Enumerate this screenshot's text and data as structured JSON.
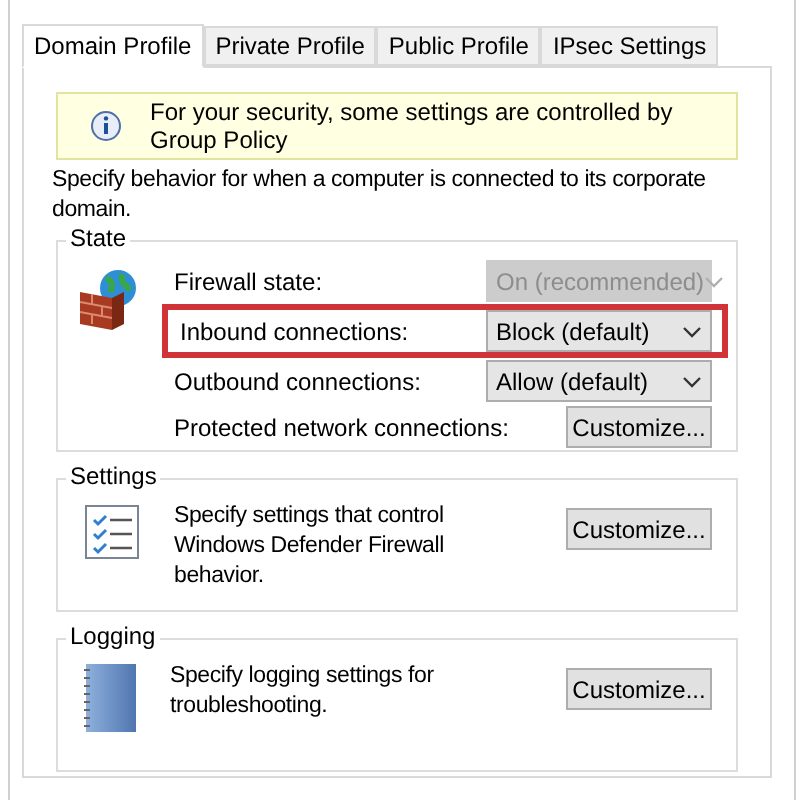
{
  "tabs": [
    {
      "label": "Domain Profile",
      "selected": true
    },
    {
      "label": "Private Profile",
      "selected": false
    },
    {
      "label": "Public Profile",
      "selected": false
    },
    {
      "label": "IPsec Settings",
      "selected": false
    }
  ],
  "banner": {
    "text": "For your security, some settings are controlled by Group Policy"
  },
  "description": "Specify behavior for when a computer is connected to its corporate domain.",
  "state": {
    "title": "State",
    "rows": [
      {
        "kind": "dropdown",
        "label": "Firewall state:",
        "value": "On (recommended)",
        "disabled": true,
        "highlighted": false
      },
      {
        "kind": "dropdown",
        "label": "Inbound connections:",
        "value": "Block (default)",
        "disabled": false,
        "highlighted": true
      },
      {
        "kind": "dropdown",
        "label": "Outbound connections:",
        "value": "Allow (default)",
        "disabled": false,
        "highlighted": false
      },
      {
        "kind": "button",
        "label": "Protected network connections:",
        "value": "Customize...",
        "disabled": false,
        "highlighted": false
      }
    ]
  },
  "groups": [
    {
      "kind": "checklist",
      "title": "Settings",
      "text": "Specify settings that control Windows Defender Firewall behavior.",
      "button": "Customize..."
    },
    {
      "kind": "log",
      "title": "Logging",
      "text": "Specify logging settings for troubleshooting.",
      "button": "Customize..."
    }
  ]
}
